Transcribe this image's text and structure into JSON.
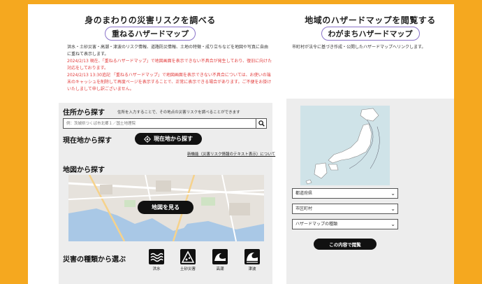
{
  "left": {
    "title": "身のまわりの災害リスクを調べる",
    "pill": "重ねるハザードマップ",
    "description": "洪水・土砂災害・高潮・津波のリスク情報、道路防災情報、土地の特徴・成り立ちなどを地図や写真に自由に重ねて表示します。",
    "notices": [
      "2024/2/13 現在、「重ねるハザードマップ」で地図画面を表示できない不具合が発生しており、復旧に向けた対応をしております。",
      "2024/2/13 13:30追記 「重ねるハザードマップ」で地図画面を表示できない不具合については、お使いの端末のキャッシュを削除して再度ページを表示することで、正常に表示できる場合があります。ご不便をお掛けいたしまして申し訳ございません。"
    ]
  },
  "address": {
    "label": "住所から探す",
    "help": "住所を入力することで、その地点の災害リスクを調べることができます",
    "placeholder": "例：茨城県つくば市北郷１／国土地理院"
  },
  "current": {
    "label": "現在地から探す",
    "button": "現在地から探す",
    "new_link": "新機能（災害リスク情報のテキスト表示）について"
  },
  "map": {
    "label": "地図から探す",
    "button": "地図を見る"
  },
  "hazard": {
    "label": "災害の種類から選ぶ",
    "items": [
      "洪水",
      "土砂災害",
      "高潮",
      "津波"
    ]
  },
  "right": {
    "title": "地域のハザードマップを閲覧する",
    "pill": "わがまちハザードマップ",
    "description": "市町村が法令に基づき作成・公開したハザードマップへリンクします。",
    "selects": [
      "都道府県",
      "市区町村",
      "ハザードマップの種類"
    ],
    "button": "この内容で閲覧"
  },
  "colors": {
    "frame": "#f5a81f",
    "notice": "#e23c3c",
    "pill_border": "#8a73c9",
    "button": "#111111"
  }
}
